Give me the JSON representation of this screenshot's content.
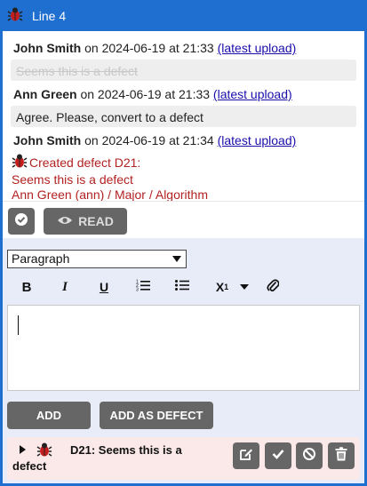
{
  "header": {
    "title": "Line 4"
  },
  "comments": [
    {
      "author": "John Smith",
      "meta": " on 2024-06-19 at 21:33 ",
      "link": "(latest upload)",
      "text": "Seems this is a defect",
      "struck": true
    },
    {
      "author": "Ann Green",
      "meta": " on 2024-06-19 at 21:33 ",
      "link": "(latest upload)",
      "text": "Agree. Please, convert to a defect",
      "struck": false
    },
    {
      "author": "John Smith",
      "meta": " on 2024-06-19 at 21:34 ",
      "link": "(latest upload)"
    }
  ],
  "defect_note": {
    "line1": "Created defect D21:",
    "line2": "Seems this is a defect",
    "line3": "Ann Green (ann) / Major / Algorithm"
  },
  "actions": {
    "read_label": "READ"
  },
  "editor": {
    "format_select": "Paragraph",
    "toolbar": {
      "bold": "B",
      "italic": "I",
      "underline": "U",
      "subscript": "X",
      "subscript_sub": "1"
    },
    "text": "",
    "add_label": "ADD",
    "add_defect_label": "ADD AS DEFECT"
  },
  "defect": {
    "title": "D21: Seems this is a defect"
  },
  "colors": {
    "header_bg": "#1e6fd0",
    "button_bg": "#666666",
    "editor_bg": "#e8ecf9",
    "defect_bg": "#fbe9e9",
    "defect_text": "#b22222"
  }
}
